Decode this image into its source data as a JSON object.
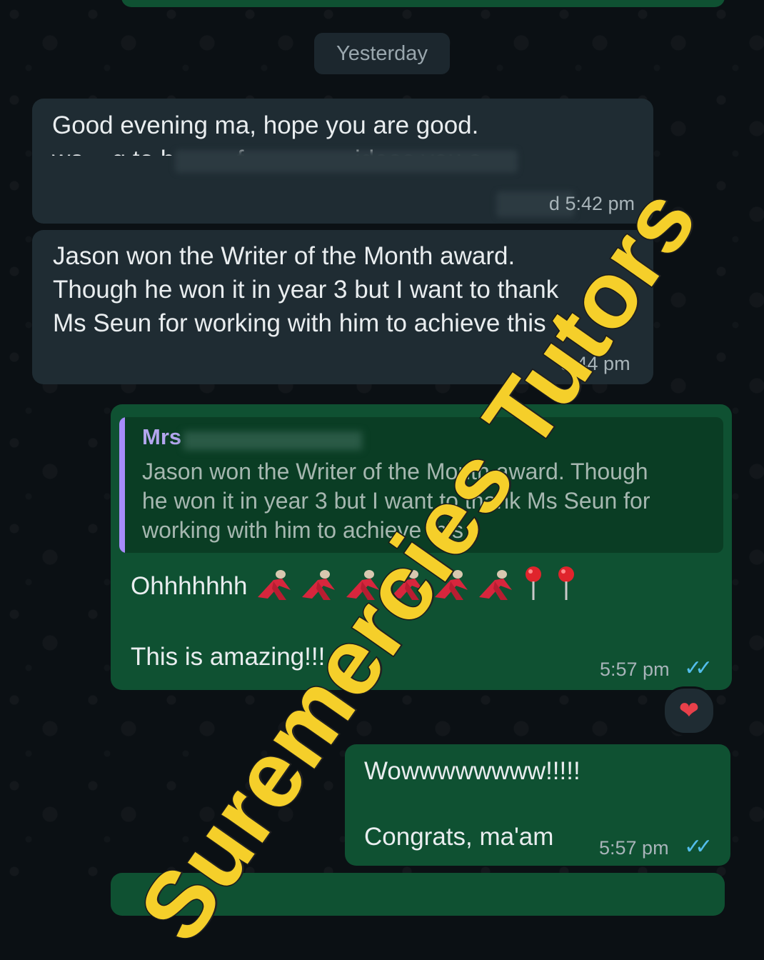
{
  "date_separator": "Yesterday",
  "messages": [
    {
      "direction": "incoming",
      "line1": "Good evening ma, hope you are good.",
      "line2_partial": "wa    g to h         f                ideas you s",
      "time": "d 5:42 pm"
    },
    {
      "direction": "incoming",
      "text": "Jason won the Writer of the Month award.\nThough he won it in year 3 but I want to thank\nMs Seun for working with him to achieve this",
      "time": "5:44 pm"
    },
    {
      "direction": "outgoing",
      "quote": {
        "author": "Mrs",
        "text": "Jason won the Writer of the Month award. Though\nhe won it in year 3 but I want to thank Ms Seun for\nworking with him to achieve this"
      },
      "line1": "Ohhhhhhh",
      "line2": "This is amazing!!!",
      "time": "5:57 pm",
      "reaction": "❤"
    },
    {
      "direction": "outgoing",
      "line1": "Wowwwwwwww!!!!!",
      "line2": "Congrats, ma'am",
      "time": "5:57 pm"
    }
  ],
  "icons": {
    "dancer": "dancer-icon",
    "pin": "pushpin-icon",
    "tick": "double-tick-icon",
    "heart": "heart-icon"
  },
  "colors": {
    "incoming_bubble": "#1f2c33",
    "outgoing_bubble": "#0f5132",
    "tick_blue": "#53bdeb",
    "watermark": "#f5cf2a",
    "quote_bar": "#a78bfa"
  },
  "watermark": "Suremercies Tutors"
}
